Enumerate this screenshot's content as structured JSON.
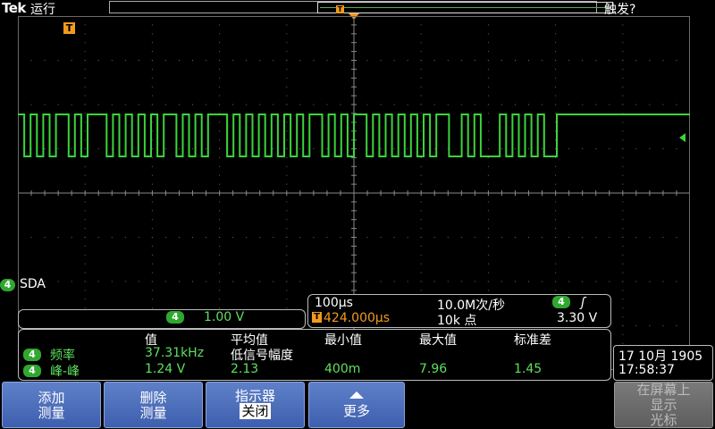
{
  "topbar": {
    "brand": "Tek",
    "run_state": "运行",
    "trigger_state": "触发?"
  },
  "channel": {
    "number": "4",
    "label": "SDA",
    "scale": "1.00 V",
    "color": "#3bd43b"
  },
  "timebase": {
    "time_per_div": "100µs",
    "sample_rate": "10.0M次/秒",
    "trigger_delay": "424.000µs",
    "record_length": "10k 点",
    "trigger_channel": "4",
    "trigger_slope": "ʃ",
    "trigger_level": "3.30 V"
  },
  "measurements": {
    "headers": [
      "值",
      "平均值",
      "最小值",
      "最大值",
      "标准差"
    ],
    "rows": [
      {
        "channel": "4",
        "name": "频率",
        "value": "37.31kHz",
        "mean": "低信号幅度",
        "min": "",
        "max": "",
        "std": ""
      },
      {
        "channel": "4",
        "name": "峰-峰",
        "value": "1.24 V",
        "mean": "2.13",
        "min": "400m",
        "max": "7.96",
        "std": "1.45"
      }
    ]
  },
  "datetime": {
    "date": "17 10月 1905",
    "time": "17:58:37"
  },
  "buttons": {
    "add_line1": "添加",
    "add_line2": "测量",
    "remove_line1": "删除",
    "remove_line2": "测量",
    "indicator_line1": "指示器",
    "indicator_line2": "关闭",
    "more": "更多",
    "cursor_line1": "在屏幕上",
    "cursor_line2": "显示",
    "cursor_line3": "光标"
  },
  "markers": {
    "trigger_marker": "T"
  },
  "waveform": {
    "bits": [
      1,
      0,
      1,
      0,
      1,
      0,
      1,
      1,
      0,
      1,
      0,
      1,
      1,
      1,
      0,
      1,
      0,
      1,
      0,
      1,
      0,
      1,
      0,
      1,
      1,
      0,
      1,
      0,
      1,
      0,
      1,
      1,
      1,
      0,
      1,
      0,
      1,
      0,
      1,
      0,
      1,
      0,
      1,
      0,
      1,
      0,
      1,
      1,
      0,
      1,
      0,
      1,
      0,
      1,
      1,
      0,
      1,
      0,
      1,
      0,
      1,
      0,
      1,
      0,
      1,
      0,
      1,
      1,
      0,
      0,
      1,
      0,
      1,
      0,
      0,
      0,
      1,
      0,
      1,
      0,
      1,
      0,
      1,
      0,
      0,
      1,
      1,
      1,
      1,
      1,
      1,
      1,
      1,
      1,
      1,
      1,
      1,
      1,
      1,
      1,
      1,
      1,
      1,
      1,
      1,
      1
    ]
  }
}
